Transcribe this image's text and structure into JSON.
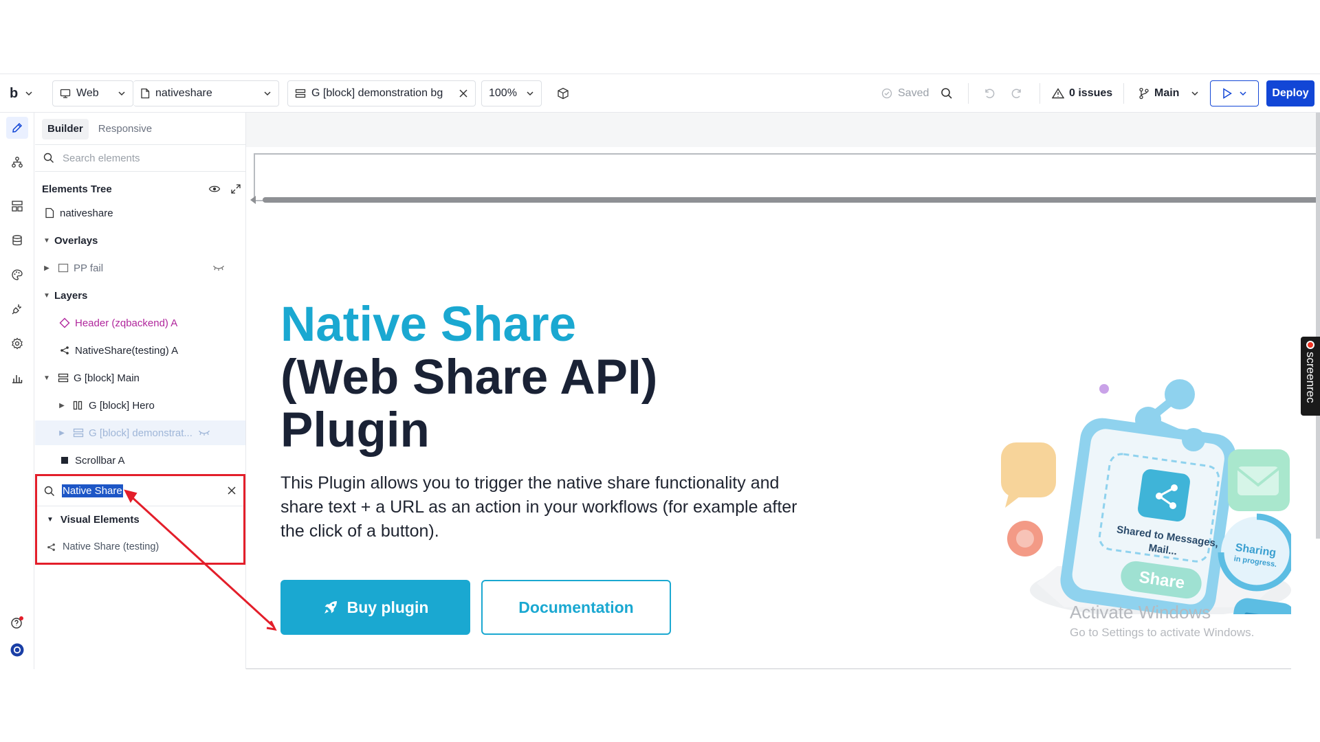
{
  "toolbar": {
    "logo": "b",
    "platform": "Web",
    "page": "nativeshare",
    "selected_element": "G [block] demonstration bg",
    "zoom": "100%",
    "saved_label": "Saved",
    "issues_label": "0 issues",
    "branch": "Main",
    "deploy_label": "Deploy"
  },
  "panel": {
    "tabs": [
      "Builder",
      "Responsive"
    ],
    "search_placeholder": "Search elements",
    "tree_title": "Elements Tree",
    "tree": [
      {
        "label": "nativeshare"
      },
      {
        "label": "Overlays"
      },
      {
        "label": "PP fail"
      },
      {
        "label": "Layers"
      },
      {
        "label": "Header (zqbackend) A"
      },
      {
        "label": "NativeShare(testing) A"
      },
      {
        "label": "G [block] Main"
      },
      {
        "label": "G [block] Hero"
      },
      {
        "label": "G [block] demonstrat..."
      },
      {
        "label": "Scrollbar A"
      }
    ]
  },
  "element_search": {
    "query": "Native Share",
    "category": "Visual Elements",
    "result": "Native Share (testing)"
  },
  "canvas": {
    "hero_line1": "Native Share",
    "hero_line2": "(Web Share API)",
    "hero_line3": "Plugin",
    "description": "This Plugin allows you to trigger the native share functionality and share text + a URL as an action in your workflows (for example after the click of a button).",
    "buy_label": "Buy plugin",
    "doc_label": "Documentation",
    "illustration": {
      "card_text_line1": "Shared to Messages,",
      "card_text_line2": "Mail...",
      "share_button": "Share",
      "progress_line1": "Sharing",
      "progress_line2": "in progress."
    }
  },
  "watermark": {
    "title": "Activate Windows",
    "subtitle": "Go to Settings to activate Windows."
  },
  "overlay": {
    "screenrec_label": "screenrec"
  },
  "colors": {
    "accent": "#1aa8d1",
    "deploy": "#1246d6",
    "highlight": "#e31e2a",
    "header_pink": "#b0269c"
  }
}
